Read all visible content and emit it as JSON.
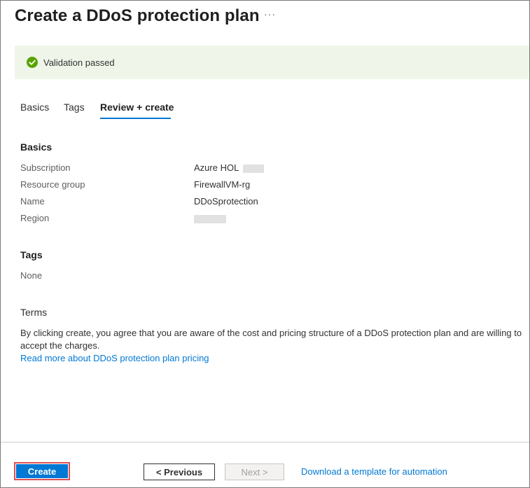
{
  "header": {
    "title": "Create a DDoS protection plan",
    "more_label": "···"
  },
  "validation": {
    "icon": "check-circle-icon",
    "text": "Validation passed",
    "color": "#57a300"
  },
  "tabs": [
    {
      "label": "Basics",
      "active": false
    },
    {
      "label": "Tags",
      "active": false
    },
    {
      "label": "Review + create",
      "active": true
    }
  ],
  "basics": {
    "heading": "Basics",
    "fields": [
      {
        "label": "Subscription",
        "value": "Azure HOL"
      },
      {
        "label": "Resource group",
        "value": "FirewallVM-rg"
      },
      {
        "label": "Name",
        "value": "DDoSprotection"
      },
      {
        "label": "Region",
        "value": ""
      }
    ]
  },
  "tags": {
    "heading": "Tags",
    "value": "None"
  },
  "terms": {
    "heading": "Terms",
    "text": "By clicking create, you agree that you are aware of the cost and pricing structure of a DDoS protection plan and are willing to accept the charges.",
    "link": "Read more about DDoS protection plan pricing"
  },
  "footer": {
    "create_label": "Create",
    "previous_label": "< Previous",
    "next_label": "Next >",
    "download_label": "Download a template for automation"
  },
  "colors": {
    "accent": "#0078d4",
    "banner_bg": "#eff6e9",
    "highlight_border": "#e05050"
  }
}
